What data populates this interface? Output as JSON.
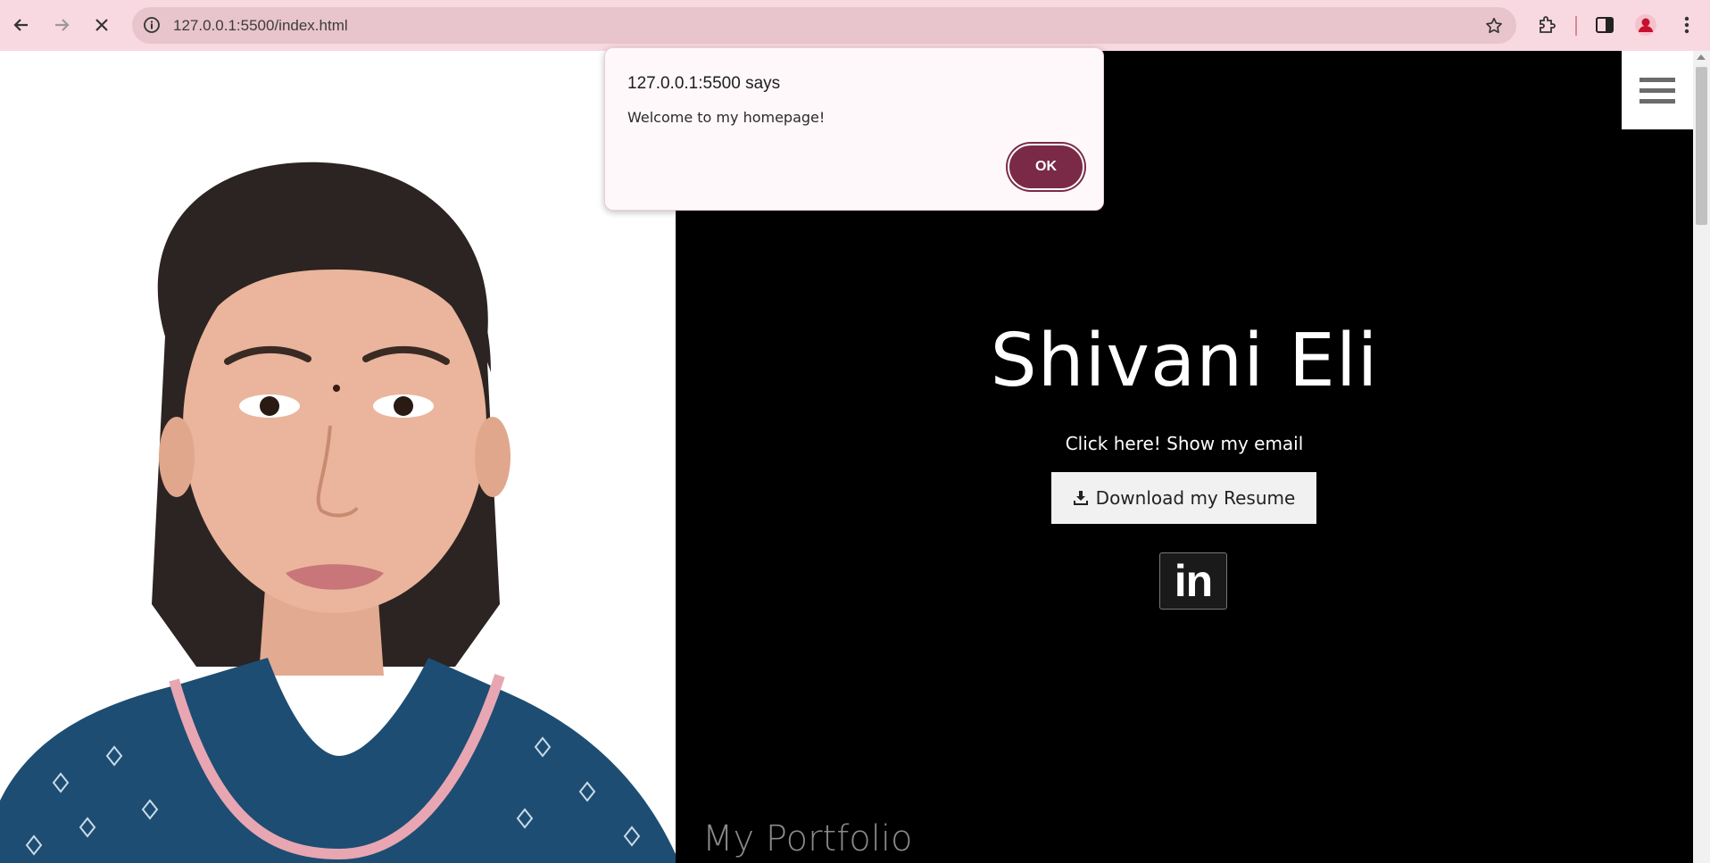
{
  "browser": {
    "url": "127.0.0.1:5500/index.html",
    "icons": {
      "back": "back-arrow-icon",
      "forward": "forward-arrow-icon",
      "stop": "close-icon",
      "info": "info-icon",
      "bookmark": "star-icon",
      "extensions": "puzzle-icon",
      "side_panel": "side-panel-icon",
      "profile": "profile-avatar-icon",
      "menu": "kebab-menu-icon"
    },
    "colors": {
      "toolbar": "#f9d9e1",
      "omnibox": "#e8c4cc",
      "profile": "#c8102e"
    }
  },
  "dialog": {
    "title": "127.0.0.1:5500 says",
    "message": "Welcome to my homepage!",
    "ok_label": "OK",
    "accent": "#7a2a46"
  },
  "hero": {
    "name": "Shivani Eli",
    "email_link": "Click here! Show my email",
    "resume_label": "Download my Resume",
    "resume_icon": "download-icon",
    "linkedin_label": "in",
    "section_title": "My Portfolio",
    "menu_icon": "hamburger-menu-icon"
  }
}
